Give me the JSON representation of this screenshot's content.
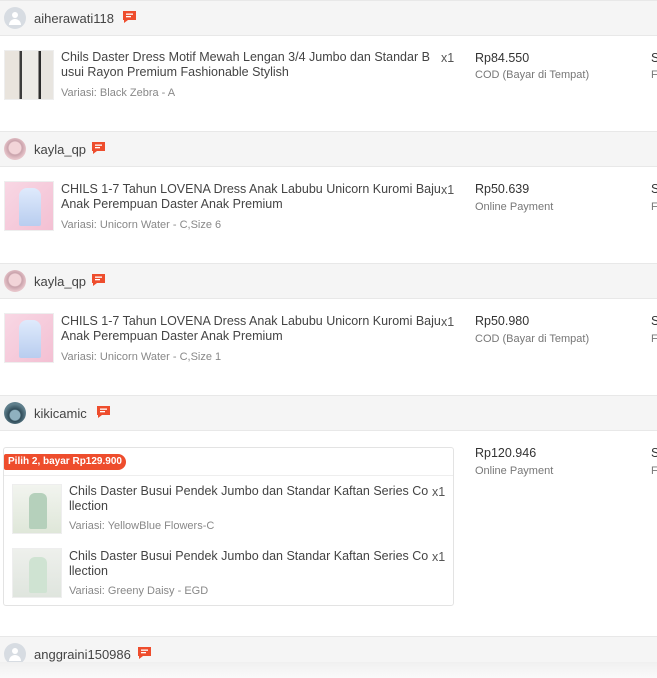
{
  "orders": [
    {
      "username": "aiherawati118",
      "avatar": "default",
      "products": [
        {
          "name_line1": "Chils Daster Dress Motif Mewah Lengan 3/4 Jumbo dan Standar B",
          "name_line2": "usui Rayon Premium Fashionable Stylish",
          "qty": "x1",
          "variant": "Variasi: Black Zebra - A"
        }
      ],
      "price": "Rp84.550",
      "payment": "COD (Bayar di Tempat)",
      "edge_line1": "S",
      "edge_line2": "F"
    },
    {
      "username": "kayla_qp",
      "avatar": "pink",
      "products": [
        {
          "name_line1": "CHILS 1-7 Tahun LOVENA Dress Anak Labubu Unicorn Kuromi Baju",
          "name_line2": "Anak Perempuan Daster Anak Premium",
          "qty": "x1",
          "variant": "Variasi: Unicorn Water - C,Size 6"
        }
      ],
      "price": "Rp50.639",
      "payment": "Online Payment",
      "edge_line1": "S",
      "edge_line2": "F"
    },
    {
      "username": "kayla_qp",
      "avatar": "pink",
      "products": [
        {
          "name_line1": "CHILS 1-7 Tahun LOVENA Dress Anak Labubu Unicorn Kuromi Baju",
          "name_line2": "Anak Perempuan Daster Anak Premium",
          "qty": "x1",
          "variant": "Variasi: Unicorn Water - C,Size 1"
        }
      ],
      "price": "Rp50.980",
      "payment": "COD (Bayar di Tempat)",
      "edge_line1": "S",
      "edge_line2": "F"
    },
    {
      "username": "kikicamic",
      "avatar": "dark",
      "bundle_label": "Pilih 2, bayar Rp129.900",
      "products": [
        {
          "name_line1": "Chils Daster Busui Pendek Jumbo dan Standar Kaftan Series Co",
          "name_line2": "llection",
          "qty": "x1",
          "variant": "Variasi: YellowBlue Flowers-C"
        },
        {
          "name_line1": "Chils Daster Busui Pendek Jumbo dan Standar Kaftan Series Co",
          "name_line2": "llection",
          "qty": "x1",
          "variant": "Variasi: Greeny Daisy - EGD"
        }
      ],
      "price": "Rp120.946",
      "payment": "Online Payment",
      "edge_line1": "S",
      "edge_line2": "F"
    },
    {
      "username": "anggraini150986",
      "avatar": "default"
    }
  ],
  "colors": {
    "accent": "#ee4d2d",
    "header_bg": "#f5f5f5"
  },
  "icons": {
    "chat": "chat-icon",
    "avatar": "user-avatar-icon"
  }
}
